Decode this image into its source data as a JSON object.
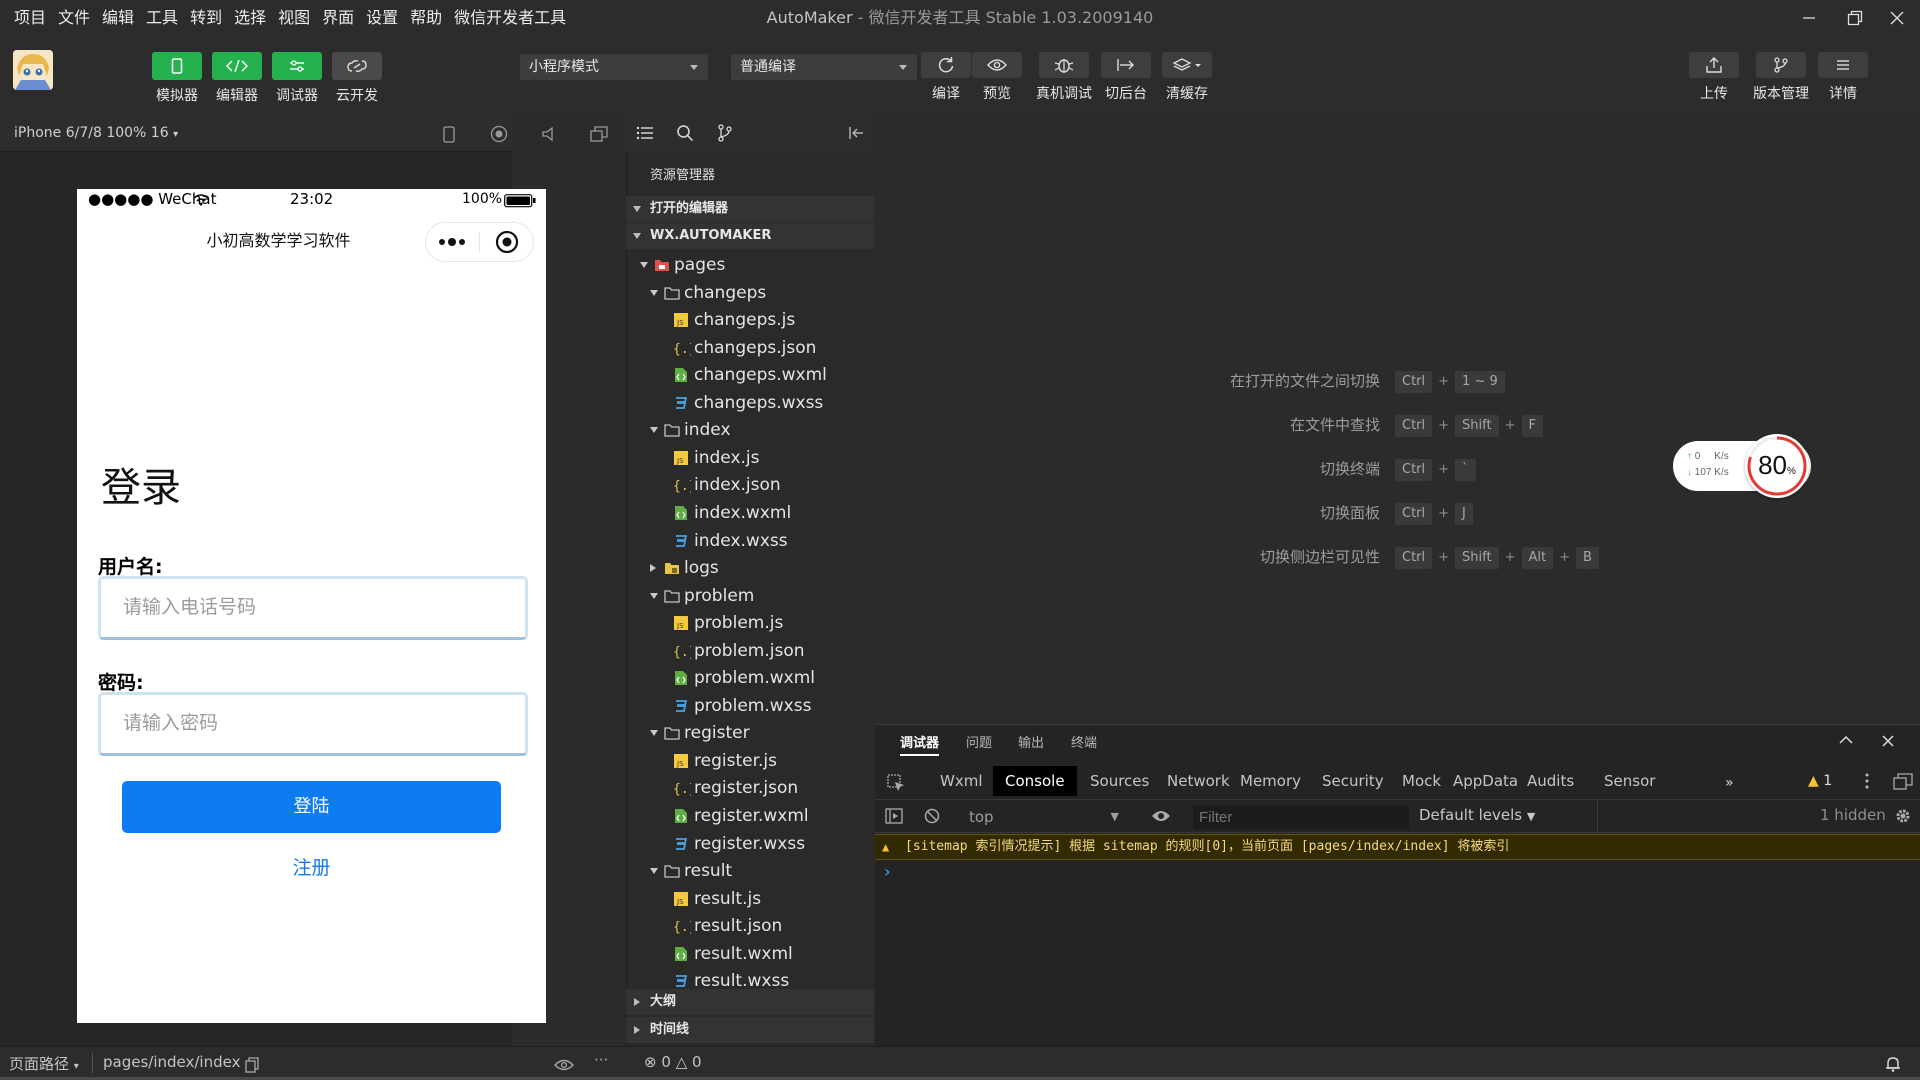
{
  "menubar": {
    "items": [
      "项目",
      "文件",
      "编辑",
      "工具",
      "转到",
      "选择",
      "视图",
      "界面",
      "设置",
      "帮助",
      "微信开发者工具"
    ],
    "title_app": "AutoMaker",
    "title_rest": " - 微信开发者工具 Stable 1.03.2009140"
  },
  "toolbar": {
    "simulator_label": "模拟器",
    "editor_label": "编辑器",
    "debugger_label": "调试器",
    "cloud_label": "云开发",
    "mode_select": "小程序模式",
    "compile_select": "普通编译",
    "compile_label": "编译",
    "preview_label": "预览",
    "remote_debug_label": "真机调试",
    "background_label": "切后台",
    "clear_cache_label": "清缓存",
    "upload_label": "上传",
    "version_label": "版本管理",
    "details_label": "详情"
  },
  "simulator": {
    "device": "iPhone 6/7/8 100% 16",
    "status_carrier": "●●●●● WeChat",
    "status_time": "23:02",
    "status_battery": "100%",
    "nav_title": "小初高数学学习软件",
    "login_heading": "登录",
    "username_label": "用户名:",
    "username_placeholder": "请输入电话号码",
    "password_label": "密码:",
    "password_placeholder": "请输入密码",
    "login_button": "登陆",
    "register_link": "注册"
  },
  "explorer": {
    "title": "资源管理器",
    "open_editors": "打开的编辑器",
    "project": "WX.AUTOMAKER",
    "tree": [
      {
        "name": "pages",
        "type": "folder-red",
        "depth": 0,
        "open": true
      },
      {
        "name": "changeps",
        "type": "folder",
        "depth": 1,
        "open": true
      },
      {
        "name": "changeps.js",
        "type": "js",
        "depth": 2
      },
      {
        "name": "changeps.json",
        "type": "json",
        "depth": 2
      },
      {
        "name": "changeps.wxml",
        "type": "wxml",
        "depth": 2
      },
      {
        "name": "changeps.wxss",
        "type": "wxss",
        "depth": 2
      },
      {
        "name": "index",
        "type": "folder",
        "depth": 1,
        "open": true
      },
      {
        "name": "index.js",
        "type": "js",
        "depth": 2
      },
      {
        "name": "index.json",
        "type": "json",
        "depth": 2
      },
      {
        "name": "index.wxml",
        "type": "wxml",
        "depth": 2
      },
      {
        "name": "index.wxss",
        "type": "wxss",
        "depth": 2
      },
      {
        "name": "logs",
        "type": "folder-yellow",
        "depth": 1,
        "open": false
      },
      {
        "name": "problem",
        "type": "folder",
        "depth": 1,
        "open": true
      },
      {
        "name": "problem.js",
        "type": "js",
        "depth": 2
      },
      {
        "name": "problem.json",
        "type": "json",
        "depth": 2
      },
      {
        "name": "problem.wxml",
        "type": "wxml",
        "depth": 2
      },
      {
        "name": "problem.wxss",
        "type": "wxss",
        "depth": 2
      },
      {
        "name": "register",
        "type": "folder",
        "depth": 1,
        "open": true
      },
      {
        "name": "register.js",
        "type": "js",
        "depth": 2
      },
      {
        "name": "register.json",
        "type": "json",
        "depth": 2
      },
      {
        "name": "register.wxml",
        "type": "wxml",
        "depth": 2
      },
      {
        "name": "register.wxss",
        "type": "wxss",
        "depth": 2
      },
      {
        "name": "result",
        "type": "folder",
        "depth": 1,
        "open": true
      },
      {
        "name": "result.js",
        "type": "js",
        "depth": 2
      },
      {
        "name": "result.json",
        "type": "json",
        "depth": 2
      },
      {
        "name": "result.wxml",
        "type": "wxml",
        "depth": 2
      },
      {
        "name": "result.wxss",
        "type": "wxss",
        "depth": 2
      }
    ],
    "outline": "大纲",
    "timeline": "时间线"
  },
  "shortcuts": [
    {
      "label": "在打开的文件之间切换",
      "keys": [
        "Ctrl",
        "1 ~ 9"
      ]
    },
    {
      "label": "在文件中查找",
      "keys": [
        "Ctrl",
        "Shift",
        "F"
      ]
    },
    {
      "label": "切换终端",
      "keys": [
        "Ctrl",
        "`"
      ]
    },
    {
      "label": "切换面板",
      "keys": [
        "Ctrl",
        "J"
      ]
    },
    {
      "label": "切换侧边栏可见性",
      "keys": [
        "Ctrl",
        "Shift",
        "Alt",
        "B"
      ]
    }
  ],
  "netmon": {
    "up": "0",
    "down": "107",
    "unit": "K/s",
    "percent": "80",
    "percent_sign": "%"
  },
  "debugger": {
    "panel_tabs": [
      "调试器",
      "问题",
      "输出",
      "终端"
    ],
    "devtools_tabs": [
      "Wxml",
      "Console",
      "Sources",
      "Network",
      "Memory",
      "Security",
      "Mock",
      "AppData",
      "Audits",
      "Sensor"
    ],
    "active_devtools_tab": "Console",
    "more": "»",
    "warning_count": "1",
    "context": "top",
    "filter_placeholder": "Filter",
    "levels": "Default levels",
    "hidden": "1 hidden",
    "warning_message": "[sitemap 索引情况提示] 根据 sitemap 的规则[0]，当前页面 [pages/index/index] 将被索引",
    "prompt": "›"
  },
  "statusbar": {
    "page_path_label": "页面路径",
    "page_path": "pages/index/index",
    "errors": "0",
    "warnings": "0",
    "more": "···"
  },
  "colors": {
    "accent_green": "#24b14e",
    "primary_blue": "#0d7cf2",
    "warning_yellow": "#f4d981"
  }
}
